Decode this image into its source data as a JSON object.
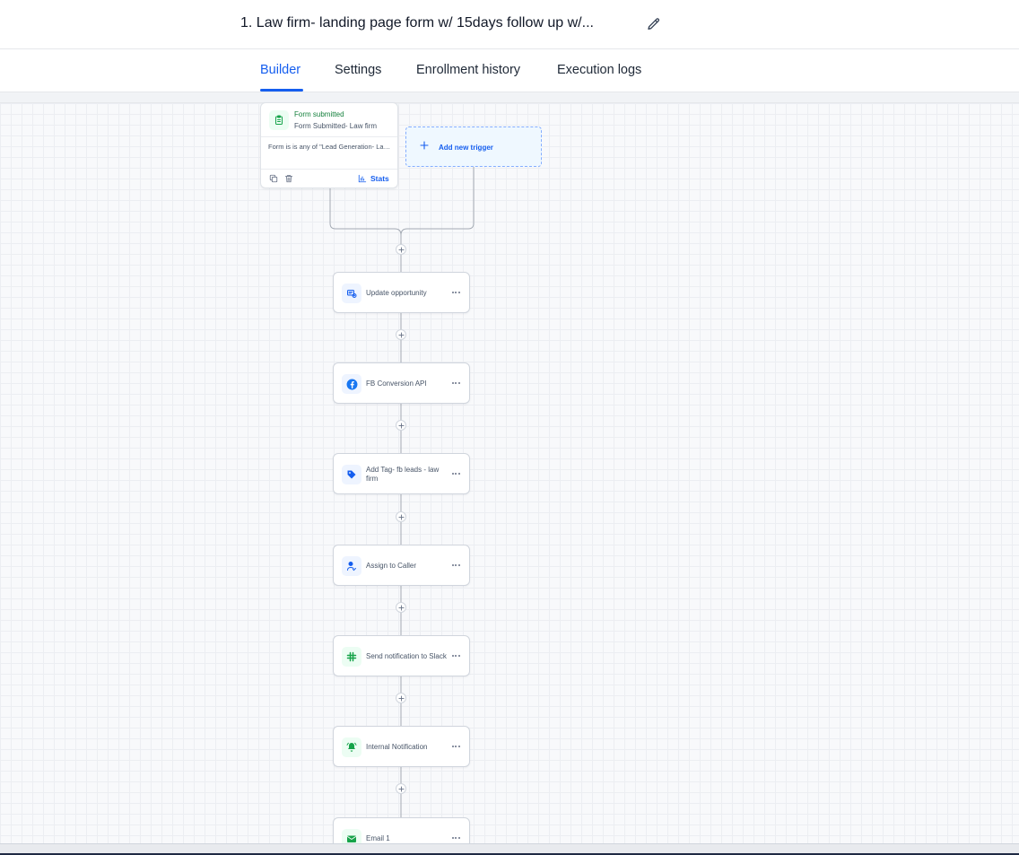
{
  "header": {
    "title": "1. Law firm- landing page form w/ 15days follow up w/...",
    "edit_icon": "pencil-icon"
  },
  "tabs": [
    {
      "label": "Builder",
      "active": true
    },
    {
      "label": "Settings",
      "active": false
    },
    {
      "label": "Enrollment history",
      "active": false
    },
    {
      "label": "Execution logs",
      "active": false
    }
  ],
  "trigger": {
    "type_label": "Form submitted",
    "name": "Form Submitted- Law firm",
    "filter": "Form is is any of \"Lead Generation- Law firm\"",
    "stats_label": "Stats",
    "icon": "clipboard-icon"
  },
  "add_trigger": {
    "label": "Add new trigger"
  },
  "actions": [
    {
      "label": "Update opportunity",
      "icon": "opportunity-icon",
      "color": "#155eef"
    },
    {
      "label": "FB Conversion API",
      "icon": "facebook-icon",
      "color": "#1877f2"
    },
    {
      "label": "Add Tag- fb leads - law firm",
      "icon": "tag-icon",
      "color": "#155eef"
    },
    {
      "label": "Assign to Caller",
      "icon": "user-assign-icon",
      "color": "#155eef"
    },
    {
      "label": "Send notification to Slack",
      "icon": "slack-icon",
      "color": "#16a34a"
    },
    {
      "label": "Internal Notification",
      "icon": "bell-icon",
      "color": "#16a34a"
    },
    {
      "label": "Email 1",
      "icon": "email-icon",
      "color": "#16a34a"
    }
  ],
  "colors": {
    "accent": "#155eef",
    "trigger_green": "#15803d"
  }
}
